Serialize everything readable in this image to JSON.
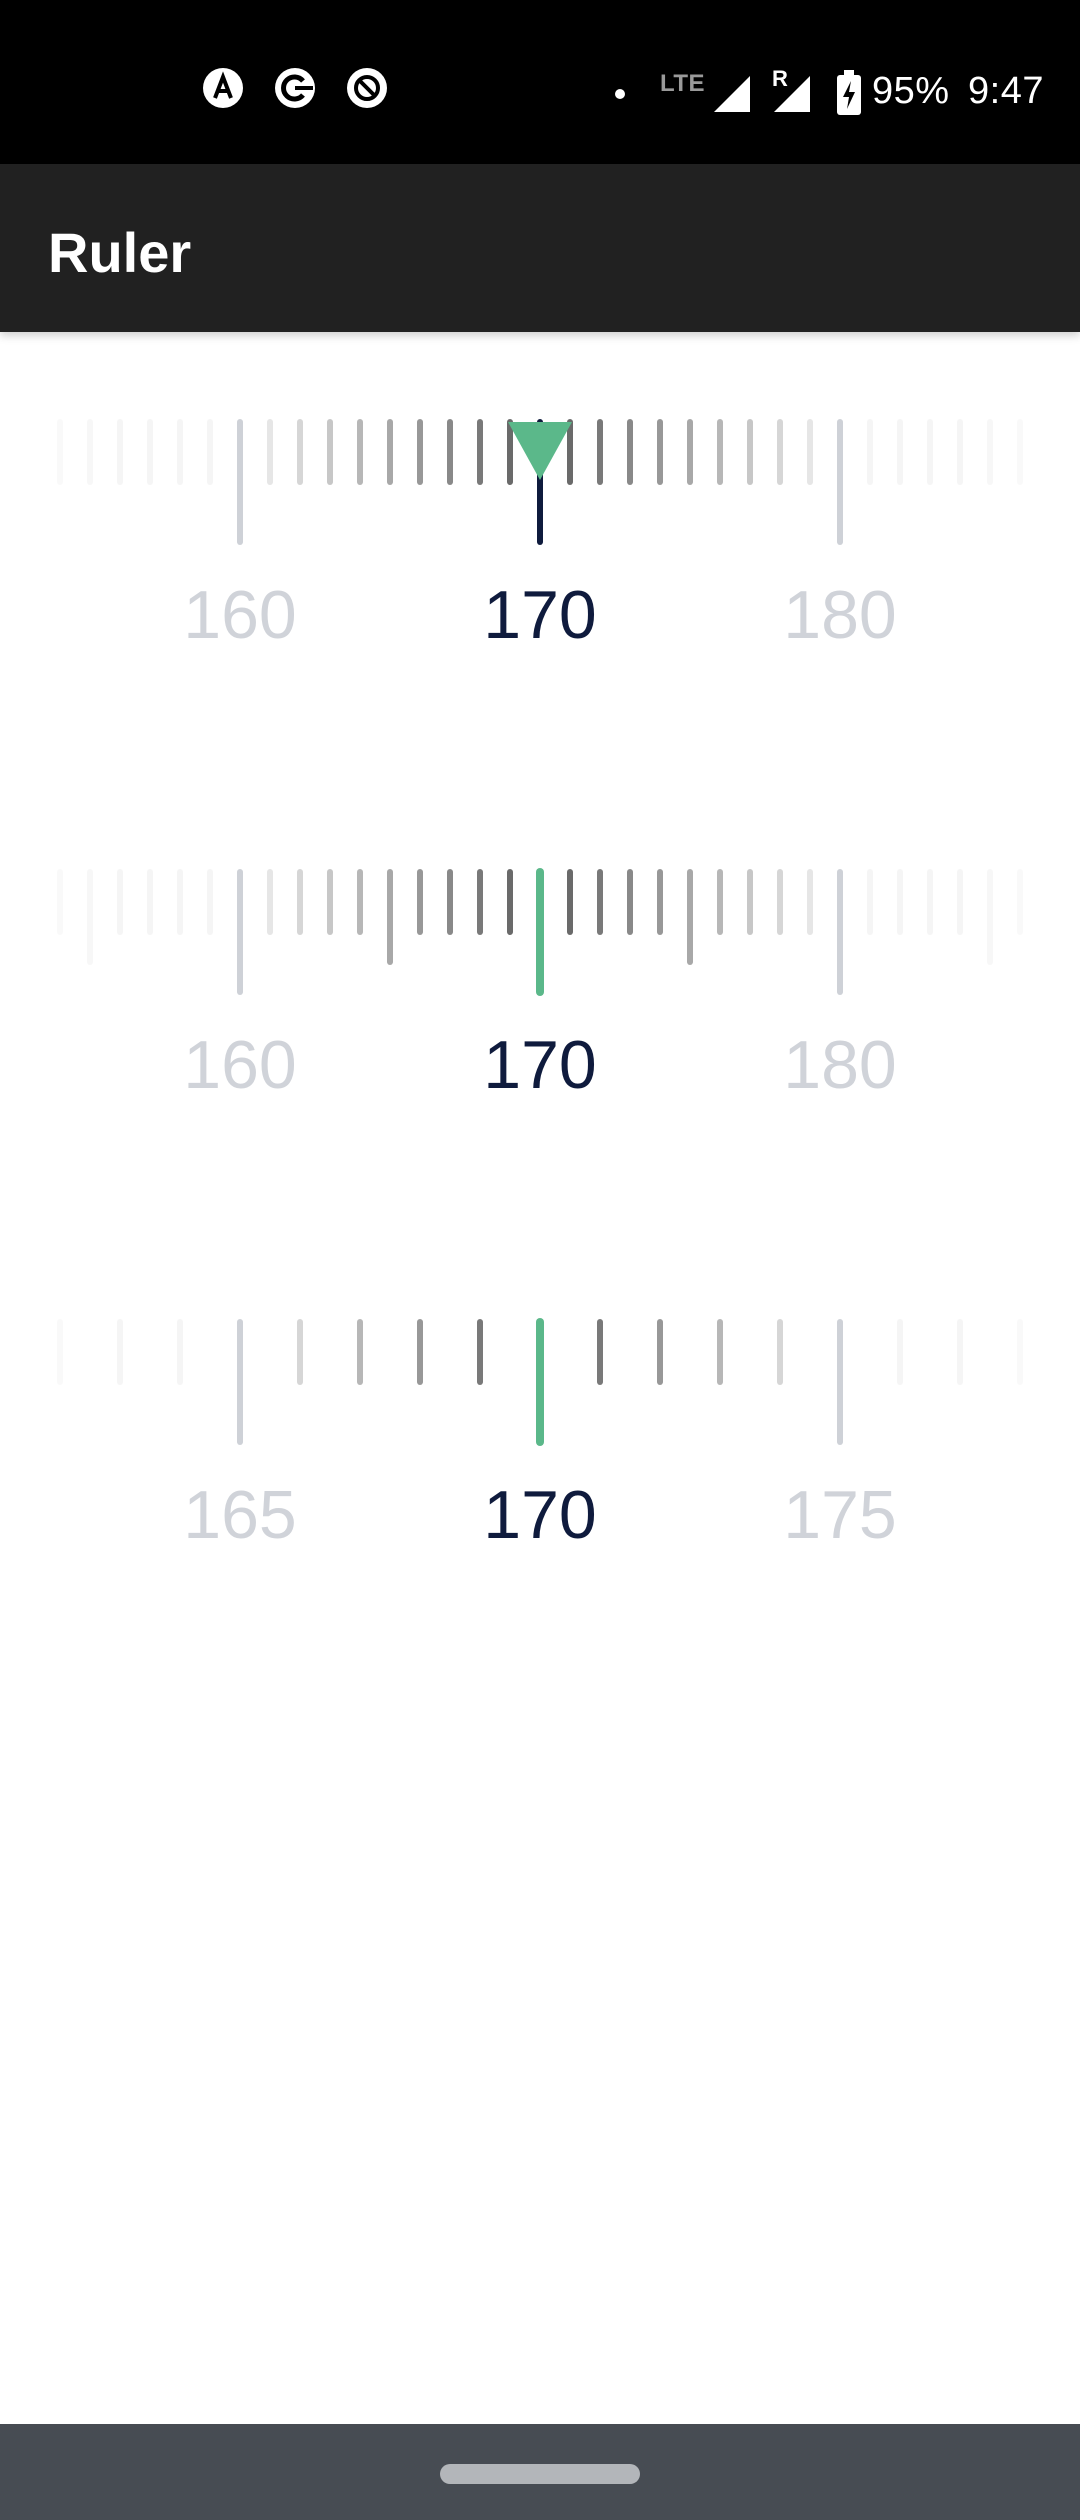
{
  "status_bar": {
    "battery": "95%",
    "time": "9:47",
    "network": "LTE",
    "roaming": "R",
    "left_icons": [
      "assistant-a-icon",
      "chrome-cast-icon",
      "do-not-disturb-icon"
    ]
  },
  "toolbar": {
    "title": "Ruler"
  },
  "colors": {
    "accent_green": "#5bb88a",
    "value_dark": "#0f1b3d",
    "label_light": "#d0d3d9",
    "toolbar_bg": "#212121",
    "nav_bg": "#474c53"
  },
  "rulers": [
    {
      "id": "ruler-arrow",
      "indicator": "triangle",
      "labels": [
        "160",
        "170",
        "180"
      ],
      "label_values": [
        160,
        170,
        180
      ],
      "selected_value": 170,
      "minor_step": 1,
      "major_step": 10,
      "half_mark_long": false
    },
    {
      "id": "ruler-line",
      "indicator": "line",
      "labels": [
        "160",
        "170",
        "180"
      ],
      "label_values": [
        160,
        170,
        180
      ],
      "selected_value": 170,
      "minor_step": 1,
      "major_step": 10,
      "half_mark_long": true
    },
    {
      "id": "ruler-coarse",
      "indicator": "line",
      "labels": [
        "165",
        "170",
        "175"
      ],
      "label_values": [
        165,
        170,
        175
      ],
      "selected_value": 170,
      "minor_step": 1,
      "major_step": 5,
      "half_mark_long": false
    }
  ]
}
